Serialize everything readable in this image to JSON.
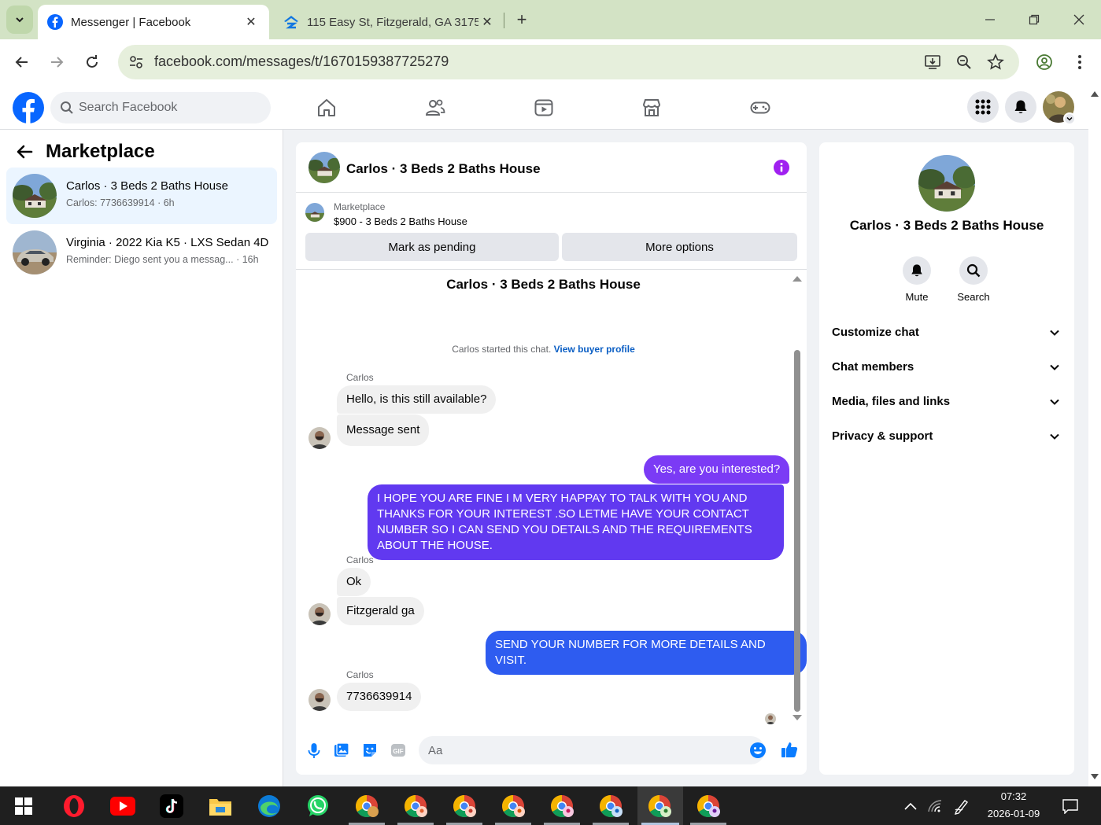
{
  "browser": {
    "tabs": [
      {
        "title": "Messenger | Facebook",
        "active": true
      },
      {
        "title": "115 Easy St, Fitzgerald, GA 3175",
        "active": false
      }
    ],
    "url": "facebook.com/messages/t/1670159387725279"
  },
  "fb": {
    "search_placeholder": "Search Facebook",
    "brand_color": "#0866ff"
  },
  "left": {
    "title": "Marketplace",
    "conversations": [
      {
        "name": "Carlos · 3 Beds 2 Baths House",
        "preview": "Carlos: 7736639914",
        "time": "6h",
        "selected": true
      },
      {
        "name": "Virginia · 2022 Kia K5 · LXS Sedan 4D",
        "preview": "Reminder: Diego sent you a messag...",
        "time": "16h",
        "selected": false
      }
    ]
  },
  "chat": {
    "title": "Carlos · 3 Beds 2 Baths House",
    "marketplace_label": "Marketplace",
    "listing": "$900 - 3 Beds 2 Baths House",
    "buttons": {
      "pending": "Mark as pending",
      "more": "More options"
    },
    "conversation_title": "Carlos · 3 Beds 2 Baths House",
    "started_text": "Carlos started this chat.",
    "buyer_profile_link": "View buyer profile",
    "messages": [
      {
        "sender": "Carlos",
        "text": "Hello, is this still available?",
        "dir": "in"
      },
      {
        "text": "Message sent",
        "dir": "in"
      },
      {
        "text": "Yes, are you interested?",
        "dir": "out"
      },
      {
        "text": "I HOPE YOU ARE FINE I M VERY HAPPAY TO TALK WITH YOU AND THANKS FOR YOUR INTEREST .SO LETME HAVE YOUR CONTACT NUMBER SO I CAN SEND YOU DETAILS AND THE REQUIREMENTS ABOUT THE HOUSE.",
        "dir": "out"
      },
      {
        "sender": "Carlos",
        "text": "Ok",
        "dir": "in"
      },
      {
        "text": "Fitzgerald ga",
        "dir": "in"
      },
      {
        "text": "SEND YOUR NUMBER FOR MORE DETAILS AND VISIT.",
        "dir": "out"
      },
      {
        "sender": "Carlos",
        "text": "7736639914",
        "dir": "in"
      }
    ],
    "composer_placeholder": "Aa",
    "accent_purple": "#7b3bf5",
    "accent_blue": "#2e5cf0"
  },
  "right": {
    "name": "Carlos · 3 Beds 2 Baths House",
    "actions": [
      {
        "label": "Mute",
        "icon": "bell-icon"
      },
      {
        "label": "Search",
        "icon": "search-icon"
      }
    ],
    "sections": [
      "Customize chat",
      "Chat members",
      "Media, files and links",
      "Privacy & support"
    ]
  },
  "taskbar": {
    "time": "07:32",
    "date": "2026-01-09"
  }
}
